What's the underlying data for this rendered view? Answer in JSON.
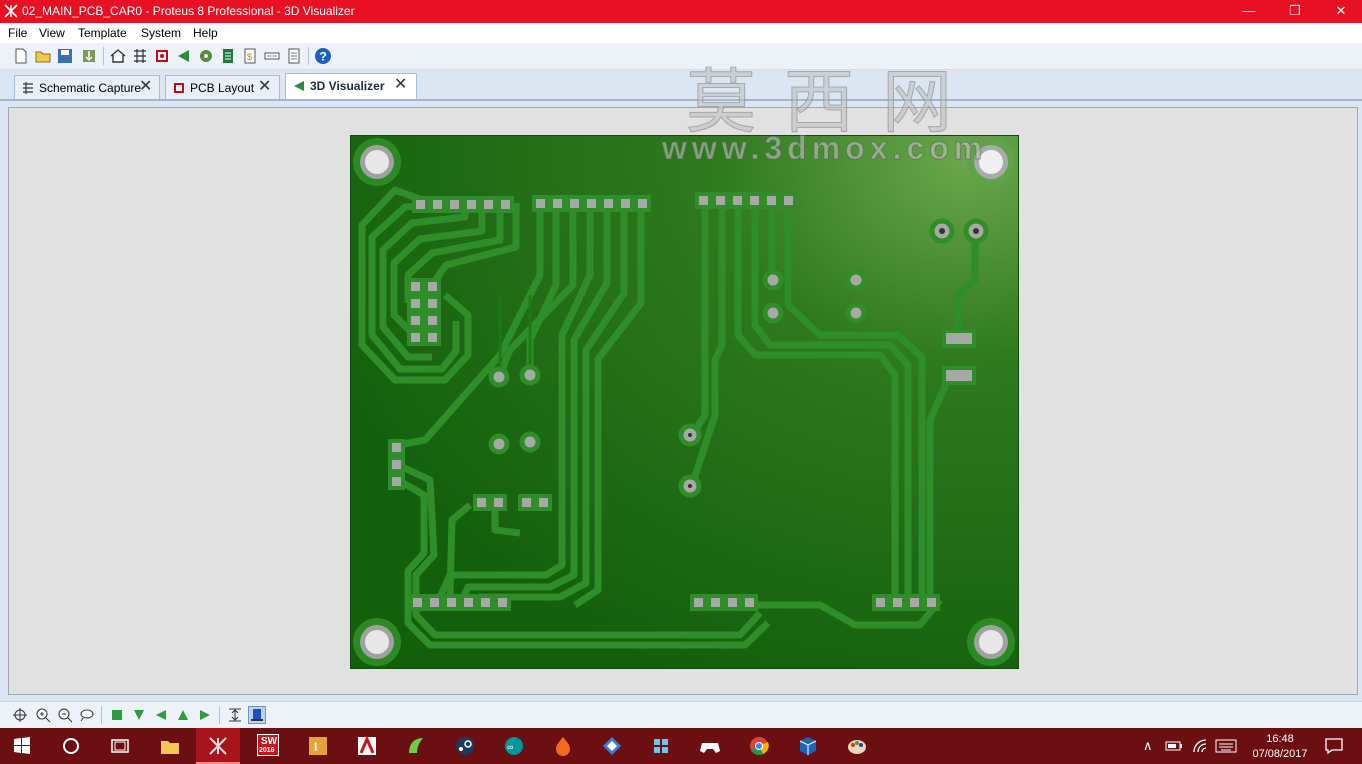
{
  "window": {
    "title": "02_MAIN_PCB_CAR0 - Proteus 8 Professional - 3D Visualizer",
    "minimize": "—",
    "restore": "❐",
    "close": "✕"
  },
  "menu": [
    "File",
    "View",
    "Template",
    "System",
    "Help"
  ],
  "toolbar": [
    "new-file-icon",
    "open-folder-icon",
    "save-icon",
    "import-icon",
    "home-icon",
    "schematic-icon",
    "pcb-icon",
    "3d-view-icon",
    "gerber-icon",
    "bom-icon",
    "design-explorer-icon",
    "notes-icon",
    "help-icon"
  ],
  "tabs": [
    {
      "label": "Schematic Capture",
      "active": false,
      "icon": "schematic-icon"
    },
    {
      "label": "PCB Layout",
      "active": false,
      "icon": "pcb-icon"
    },
    {
      "label": "3D Visualizer",
      "active": true,
      "icon": "3d-visualizer-icon"
    }
  ],
  "watermark": {
    "chinese": "莫西网",
    "url": "www.3dmox.com"
  },
  "colors": {
    "titlebar": "#e81123",
    "board": "#1a6a12",
    "trace": "#2f8d2a",
    "pad": "#a6a9a6",
    "taskbar": "#6b0f12"
  },
  "bottom_toolbar": [
    "pan-icon",
    "zoom-in-icon",
    "zoom-out-icon",
    "zoom-extents-icon",
    "top-view-icon",
    "front-view-icon",
    "left-view-icon",
    "back-view-icon",
    "right-view-icon",
    "height-icon",
    "board-view-icon"
  ],
  "taskbar": {
    "apps": [
      "windows-start-icon",
      "cortana-icon",
      "task-view-icon",
      "file-explorer-icon",
      "proteus-icon",
      "solidworks-icon",
      "inventor-icon",
      "autocad-icon",
      "app-green-icon",
      "steam-icon",
      "arduino-icon",
      "app-orange-icon",
      "app-diamond-icon",
      "app-puzzle-icon",
      "gamepad-icon",
      "chrome-icon",
      "virtualbox-icon",
      "paint-icon"
    ],
    "solidworks_badge": "SW",
    "solidworks_year": "2016",
    "time": "16:48",
    "date": "07/08/2017"
  }
}
